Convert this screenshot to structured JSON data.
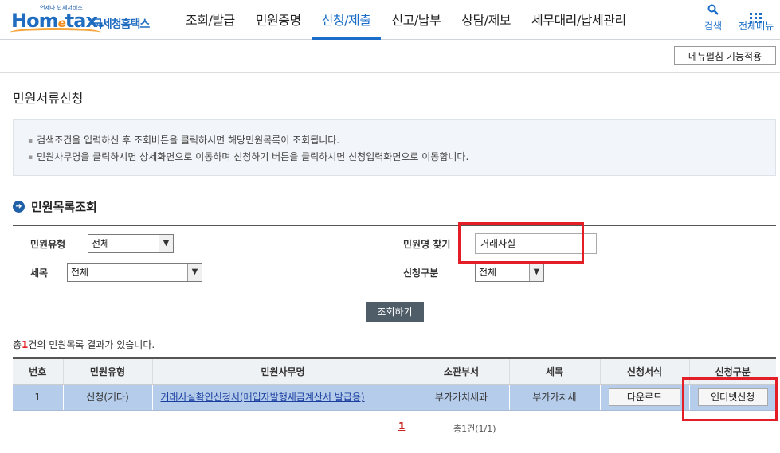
{
  "header": {
    "logo": {
      "tagline": "언제나 납세서비스",
      "brand": "Hometax",
      "sub": "국세청홈택스"
    },
    "nav": [
      "조회/발급",
      "민원증명",
      "신청/제출",
      "신고/납부",
      "상담/제보",
      "세무대리/납세관리"
    ],
    "search_label": "검색",
    "all_menu_label": "전체메뉴"
  },
  "toolbar": {
    "menu_edit_label": "메뉴펼침 기능적용"
  },
  "page": {
    "title": "민원서류신청"
  },
  "info": {
    "lines": [
      "검색조건을 입력하신 후 조회버튼을 클릭하시면 해당민원목록이 조회됩니다.",
      "민원사무명을 클릭하시면 상세화면으로 이동하며  신청하기 버튼을 클릭하시면 신청입력화면으로 이동합니다."
    ]
  },
  "section": {
    "title": "민원목록조회"
  },
  "search": {
    "type_label": "민원유형",
    "type_value": "전체",
    "name_label": "민원명 찾기",
    "name_value": "거래사실",
    "tax_label": "세목",
    "tax_value": "전체",
    "apply_label": "신청구분",
    "apply_value": "전체",
    "button_label": "조회하기"
  },
  "result": {
    "prefix": "총",
    "count": "1",
    "suffix": "건의 민원목록 결과가 있습니다."
  },
  "table": {
    "headers": [
      "번호",
      "민원유형",
      "민원사무명",
      "소관부서",
      "세목",
      "신청서식",
      "신청구분"
    ],
    "rows": [
      {
        "no": "1",
        "type": "신청(기타)",
        "name": "거래사실확인신청서(매입자발행세금계산서 발급용)",
        "dept": "부가가치세과",
        "tax": "부가가치세",
        "form_button": "다운로드",
        "apply_button": "인터넷신청"
      }
    ]
  },
  "pagination": {
    "current": "1",
    "total": "총1건(1/1)"
  },
  "colors": {
    "accent": "#1a6dc8",
    "highlight": "#e41e26",
    "row_selected": "#b5ccea"
  }
}
